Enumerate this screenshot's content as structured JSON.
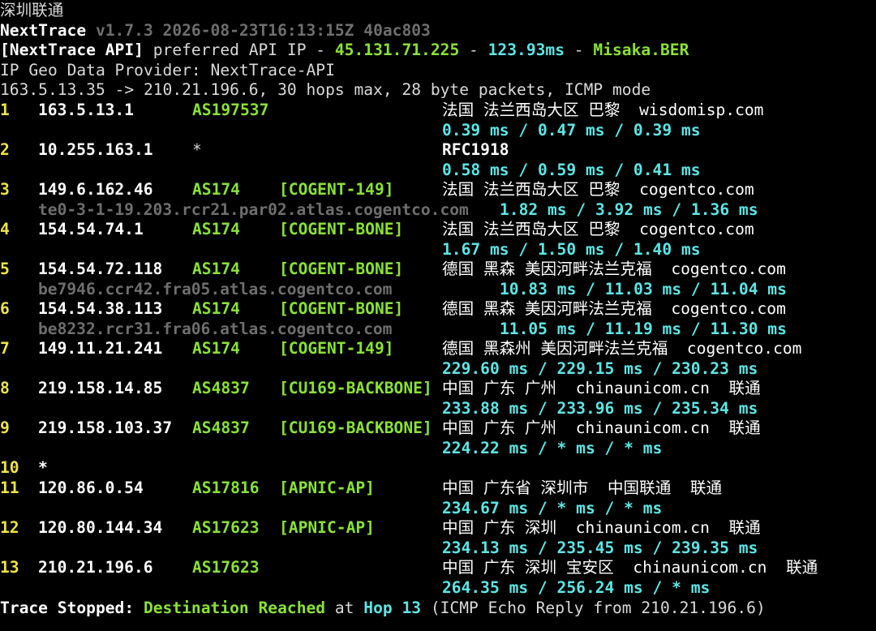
{
  "window_title": "深圳联通",
  "header": {
    "app_name": "NextTrace",
    "version_info": "v1.7.3 2026-08-23T16:13:15Z 40ac803",
    "api_tag": "[NextTrace API]",
    "api_text": " preferred API IP - ",
    "api_ip": "45.131.71.225",
    "sep1": " - ",
    "api_latency": "123.93ms",
    "sep2": " - ",
    "api_node": "Misaka.BER",
    "geo_provider": "IP Geo Data Provider: NextTrace-API",
    "trace_info": "163.5.13.35 -> 210.21.196.6, 30 hops max, 28 byte packets, ICMP mode"
  },
  "hops": [
    {
      "hop": "1",
      "ip": "163.5.13.1",
      "asn": "AS197537",
      "net": "",
      "geo": "法国 法兰西岛大区 巴黎",
      "domain": "wisdomisp.com",
      "isp": "",
      "rdns": "",
      "rtt": "0.39 ms / 0.47 ms / 0.39 ms"
    },
    {
      "hop": "2",
      "ip": "10.255.163.1",
      "asn": "*",
      "net": "",
      "geo": "RFC1918",
      "domain": "",
      "isp": "",
      "rdns": "",
      "rtt": "0.58 ms / 0.59 ms / 0.41 ms"
    },
    {
      "hop": "3",
      "ip": "149.6.162.46",
      "asn": "AS174",
      "net": "[COGENT-149]",
      "geo": "法国 法兰西岛大区 巴黎",
      "domain": "cogentco.com",
      "isp": "",
      "rdns": "te0-3-1-19.203.rcr21.par02.atlas.cogentco.com",
      "rtt": "1.82 ms / 3.92 ms / 1.36 ms"
    },
    {
      "hop": "4",
      "ip": "154.54.74.1",
      "asn": "AS174",
      "net": "[COGENT-BONE]",
      "geo": "法国 法兰西岛大区 巴黎",
      "domain": "cogentco.com",
      "isp": "",
      "rdns": "",
      "rtt": "1.67 ms / 1.50 ms / 1.40 ms"
    },
    {
      "hop": "5",
      "ip": "154.54.72.118",
      "asn": "AS174",
      "net": "[COGENT-BONE]",
      "geo": "德国 黑森 美因河畔法兰克福",
      "domain": "cogentco.com",
      "isp": "",
      "rdns": "be7946.ccr42.fra05.atlas.cogentco.com",
      "rtt": "10.83 ms / 11.03 ms / 11.04 ms"
    },
    {
      "hop": "6",
      "ip": "154.54.38.113",
      "asn": "AS174",
      "net": "[COGENT-BONE]",
      "geo": "德国 黑森 美因河畔法兰克福",
      "domain": "cogentco.com",
      "isp": "",
      "rdns": "be8232.rcr31.fra06.atlas.cogentco.com",
      "rtt": "11.05 ms / 11.19 ms / 11.30 ms"
    },
    {
      "hop": "7",
      "ip": "149.11.21.241",
      "asn": "AS174",
      "net": "[COGENT-149]",
      "geo": "德国 黑森州 美因河畔法兰克福",
      "domain": "cogentco.com",
      "isp": "",
      "rdns": "",
      "rtt": "229.60 ms / 229.15 ms / 230.23 ms"
    },
    {
      "hop": "8",
      "ip": "219.158.14.85",
      "asn": "AS4837",
      "net": "[CU169-BACKBONE]",
      "geo": "中国 广东 广州",
      "domain": "chinaunicom.cn",
      "isp": "联通",
      "rdns": "",
      "rtt": "233.88 ms / 233.96 ms / 235.34 ms"
    },
    {
      "hop": "9",
      "ip": "219.158.103.37",
      "asn": "AS4837",
      "net": "[CU169-BACKBONE]",
      "geo": "中国 广东 广州",
      "domain": "chinaunicom.cn",
      "isp": "联通",
      "rdns": "",
      "rtt": "224.22 ms / * ms / * ms"
    },
    {
      "hop": "10",
      "ip": "*",
      "asn": "",
      "net": "",
      "geo": "",
      "domain": "",
      "isp": "",
      "rdns": "",
      "rtt": ""
    },
    {
      "hop": "11",
      "ip": "120.86.0.54",
      "asn": "AS17816",
      "net": "[APNIC-AP]",
      "geo": "中国 广东省 深圳市",
      "domain": "中国联通",
      "isp": "联通",
      "rdns": "",
      "rtt": "234.67 ms / * ms / * ms"
    },
    {
      "hop": "12",
      "ip": "120.80.144.34",
      "asn": "AS17623",
      "net": "[APNIC-AP]",
      "geo": "中国 广东 深圳",
      "domain": "chinaunicom.cn",
      "isp": "联通",
      "rdns": "",
      "rtt": "234.13 ms / 235.45 ms / 239.35 ms"
    },
    {
      "hop": "13",
      "ip": "210.21.196.6",
      "asn": "AS17623",
      "net": "",
      "geo": "中国 广东 深圳 宝安区",
      "domain": "chinaunicom.cn",
      "isp": "联通",
      "rdns": "",
      "rtt": "264.35 ms / 256.24 ms / * ms"
    }
  ],
  "footer": {
    "label": "Trace Stopped:",
    "status": "Destination Reached",
    "at": " at ",
    "hop": "Hop 13",
    "detail": " (ICMP Echo Reply from 210.21.196.6)"
  },
  "colors": {
    "background": "#000000",
    "white": "#ffffff",
    "green": "#8ae234",
    "cyan": "#5ce6e6",
    "yellow": "#f0e442",
    "dim": "#6e6e6e",
    "text": "#d9d9d9"
  }
}
